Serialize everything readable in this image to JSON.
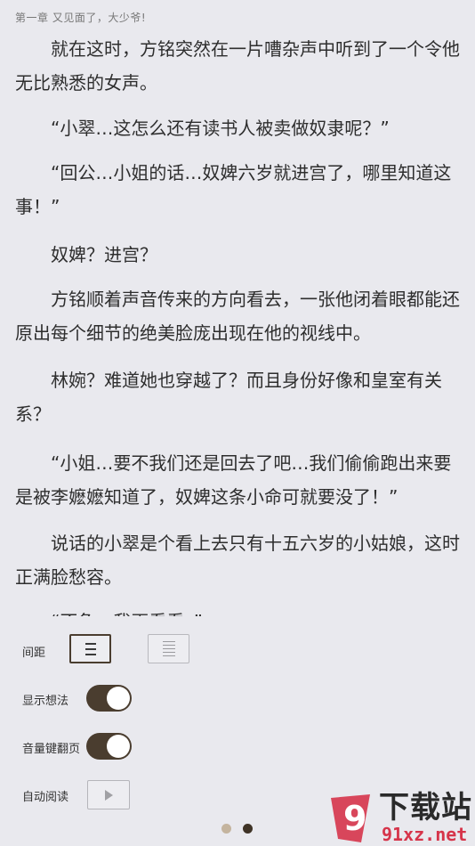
{
  "chapter": {
    "title": "第一章 又见面了，大少爷!"
  },
  "paragraphs": [
    "就在这时，方铭突然在一片嘈杂声中听到了一个令他无比熟悉的女声。",
    "“小翠…这怎么还有读书人被卖做奴隶呢？”",
    "“回公…小姐的话…奴婢六岁就进宫了，哪里知道这事！”",
    "奴婢？进宫？",
    "方铭顺着声音传来的方向看去，一张他闭着眼都能还原出每个细节的绝美脸庞出现在他的视线中。",
    "林婉？难道她也穿越了？而且身份好像和皇室有关系？",
    "“小姐…要不我们还是回去了吧…我们偷偷跑出来要是被李嬷嬷知道了，奴婢这条小命可就要没了！”",
    "说话的小翠是个看上去只有十五六岁的小姑娘，这时正满脸愁容。",
    "“不急，我再看看。”"
  ],
  "settings": {
    "spacing_label": "间距",
    "show_thoughts_label": "显示想法",
    "show_thoughts_on": true,
    "volume_key_label": "音量键翻页",
    "volume_key_on": true,
    "auto_read_label": "自动阅读"
  },
  "pager": {
    "count": 2,
    "active": 1
  },
  "colors": {
    "accent": "#4a3d2f",
    "background": "#e9e9ee",
    "dot_inactive": "#c4b49e",
    "dot_active": "#3f3326"
  },
  "watermark": {
    "brand": "下载站",
    "url": "91xz.net",
    "logo_text": "9"
  }
}
